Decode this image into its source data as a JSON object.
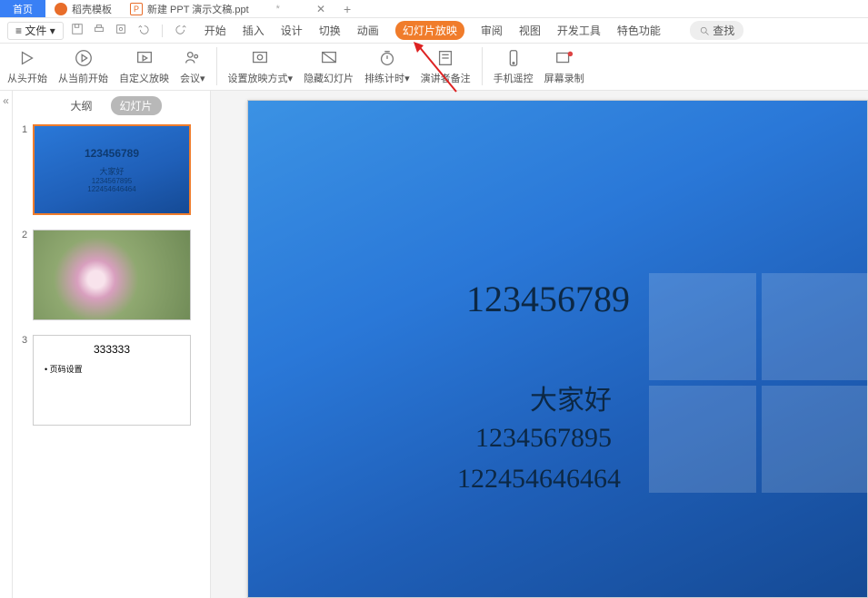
{
  "tabs": {
    "home": "首页",
    "templates": "稻壳模板",
    "doc": "新建 PPT 演示文稿.ppt",
    "close": "✕",
    "add": "+"
  },
  "menubar": {
    "file": "文件",
    "arrow": "▾",
    "items": [
      "开始",
      "插入",
      "设计",
      "切换",
      "动画",
      "幻灯片放映",
      "审阅",
      "视图",
      "开发工具",
      "特色功能"
    ],
    "search_label": "查找"
  },
  "ribbon": {
    "from_start": "从头开始",
    "from_current": "从当前开始",
    "custom": "自定义放映",
    "meeting": "会议",
    "settings": "设置放映方式",
    "hide": "隐藏幻灯片",
    "rehearse": "排练计时",
    "notes": "演讲者备注",
    "phone": "手机遥控",
    "record": "屏幕录制",
    "drop": "▾"
  },
  "sidebar": {
    "outline": "大纲",
    "slide": "幻灯片",
    "nums": [
      "1",
      "2",
      "3"
    ],
    "t1a": "123456789",
    "t1b": "大家好",
    "t1c": "1234567895",
    "t1d": "122454646464",
    "t3a": "333333",
    "t3b": "• 页码设置"
  },
  "slide": {
    "l1": "123456789",
    "l2": "大家好",
    "l3": "1234567895",
    "l4": "122454646464"
  },
  "left_collapse": "«"
}
